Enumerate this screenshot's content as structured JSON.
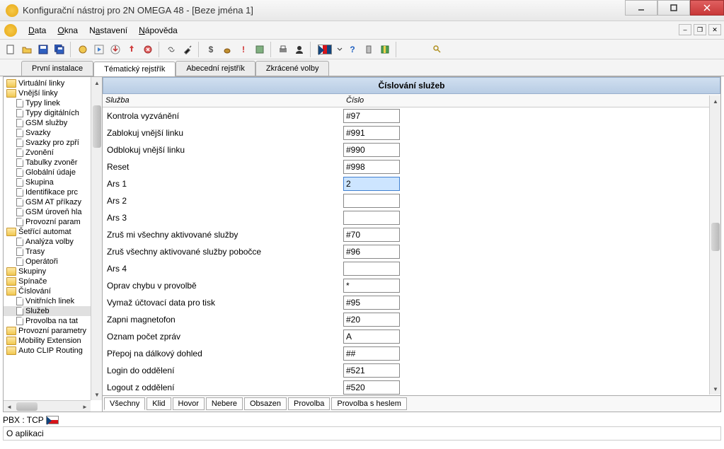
{
  "title": "Konfigurační nástroj pro 2N OMEGA 48 - [Beze jména 1]",
  "menu": {
    "data": "Data",
    "okna": "Okna",
    "nastaveni": "Nastavení",
    "napoveda": "Nápověda"
  },
  "tabs": {
    "t1": "První instalace",
    "t2": "Tématický rejstřík",
    "t3": "Abecední rejstřík",
    "t4": "Zkrácené volby"
  },
  "tree": [
    {
      "type": "folder",
      "label": "Virtuální linky",
      "indent": 0
    },
    {
      "type": "folder",
      "label": "Vnější linky",
      "indent": 0,
      "open": true
    },
    {
      "type": "page",
      "label": "Typy linek",
      "indent": 1
    },
    {
      "type": "page",
      "label": "Typy digitálních",
      "indent": 1
    },
    {
      "type": "page",
      "label": "GSM služby",
      "indent": 1
    },
    {
      "type": "page",
      "label": "Svazky",
      "indent": 1
    },
    {
      "type": "page",
      "label": "Svazky pro zpří",
      "indent": 1
    },
    {
      "type": "page",
      "label": "Zvonění",
      "indent": 1
    },
    {
      "type": "page",
      "label": "Tabulky zvoněr",
      "indent": 1
    },
    {
      "type": "page",
      "label": "Globální údaje",
      "indent": 1
    },
    {
      "type": "page",
      "label": "Skupina",
      "indent": 1
    },
    {
      "type": "page",
      "label": "Identifikace prc",
      "indent": 1
    },
    {
      "type": "page",
      "label": "GSM AT příkazy",
      "indent": 1
    },
    {
      "type": "page",
      "label": "GSM úroveň hla",
      "indent": 1
    },
    {
      "type": "page",
      "label": "Provozní param",
      "indent": 1
    },
    {
      "type": "folder",
      "label": "Šetřící automat",
      "indent": 0,
      "open": true
    },
    {
      "type": "page",
      "label": "Analýza volby",
      "indent": 1
    },
    {
      "type": "page",
      "label": "Trasy",
      "indent": 1
    },
    {
      "type": "page",
      "label": "Operátoři",
      "indent": 1
    },
    {
      "type": "folder",
      "label": "Skupiny",
      "indent": 0
    },
    {
      "type": "folder",
      "label": "Spínače",
      "indent": 0
    },
    {
      "type": "folder",
      "label": "Číslování",
      "indent": 0,
      "open": true
    },
    {
      "type": "page",
      "label": "Vnitřních linek",
      "indent": 1
    },
    {
      "type": "page",
      "label": "Služeb",
      "indent": 1,
      "selected": true
    },
    {
      "type": "page",
      "label": "Provolba na tat",
      "indent": 1
    },
    {
      "type": "folder",
      "label": "Provozní parametry",
      "indent": 0
    },
    {
      "type": "folder",
      "label": "Mobility Extension",
      "indent": 0
    },
    {
      "type": "folder",
      "label": "Auto CLIP Routing",
      "indent": 0
    }
  ],
  "content": {
    "title": "Číslování služeb",
    "col1": "Služba",
    "col2": "Číslo",
    "rows": [
      {
        "label": "Kontrola vyzvánění",
        "value": "#97"
      },
      {
        "label": "Zablokuj vnější linku",
        "value": "#991"
      },
      {
        "label": "Odblokuj vnější linku",
        "value": "#990"
      },
      {
        "label": "Reset",
        "value": "#998"
      },
      {
        "label": "Ars 1",
        "value": "2",
        "active": true
      },
      {
        "label": "Ars 2",
        "value": ""
      },
      {
        "label": "Ars 3",
        "value": ""
      },
      {
        "label": "Zruš mi všechny aktivované služby",
        "value": "#70"
      },
      {
        "label": "Zruš všechny aktivované služby pobočce",
        "value": "#96"
      },
      {
        "label": "Ars 4",
        "value": ""
      },
      {
        "label": "Oprav chybu v provolbě",
        "value": "*"
      },
      {
        "label": "Vymaž účtovací data pro tisk",
        "value": "#95"
      },
      {
        "label": "Zapni  magnetofon",
        "value": "#20"
      },
      {
        "label": "Oznam počet zpráv",
        "value": "A"
      },
      {
        "label": "Přepoj na dálkový dohled",
        "value": "##"
      },
      {
        "label": "Login do oddělení",
        "value": "#521"
      },
      {
        "label": "Logout z oddělení",
        "value": "#520"
      }
    ]
  },
  "filters": {
    "vsechny": "Všechny",
    "klid": "Klid",
    "hovor": "Hovor",
    "nebere": "Nebere",
    "obsazen": "Obsazen",
    "provolba": "Provolba",
    "provolba_heslem": "Provolba s heslem"
  },
  "status": {
    "pbx": "PBX : TCP",
    "about": "O aplikaci"
  }
}
